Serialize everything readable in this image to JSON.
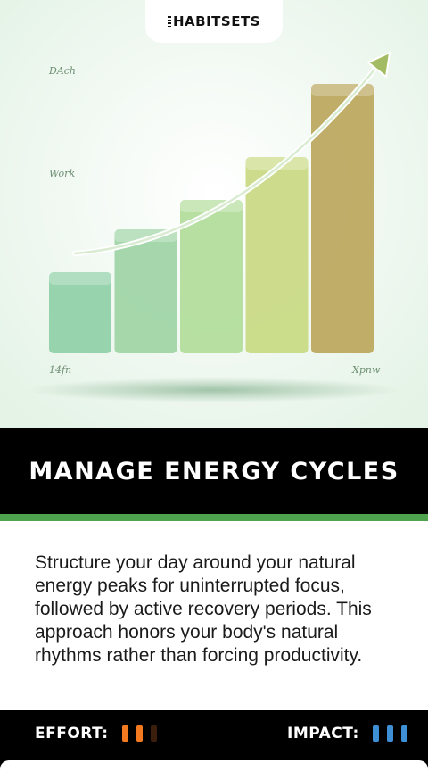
{
  "brand": {
    "name": "HABITSETS"
  },
  "illustration": {
    "label_top_left": "DAch",
    "label_mid_left": "Work",
    "label_bottom_left": "14fn",
    "label_bottom_right": "Xpnw",
    "bar_levels": [
      0.3,
      0.46,
      0.57,
      0.73,
      1.0
    ],
    "bar_colors": [
      "#8fcfa7",
      "#9ed4a5",
      "#b1dc9a",
      "#c8d982",
      "#bba65c"
    ]
  },
  "card": {
    "title": "MANAGE ENERGY CYCLES",
    "description": "Structure your day around your natural energy peaks for uninterrupted focus, followed by active recovery periods. This approach honors your body's natural rhythms rather than forcing productivity."
  },
  "footer": {
    "effort": {
      "label": "EFFORT:",
      "level": 2,
      "max": 3,
      "color": "#f47a20",
      "inactive_color": "#3b1e0c"
    },
    "impact": {
      "label": "IMPACT:",
      "level": 3,
      "max": 3,
      "color": "#3e8fd6"
    }
  },
  "colors": {
    "accent_green": "#4fa34f",
    "title_bg": "#000000"
  }
}
